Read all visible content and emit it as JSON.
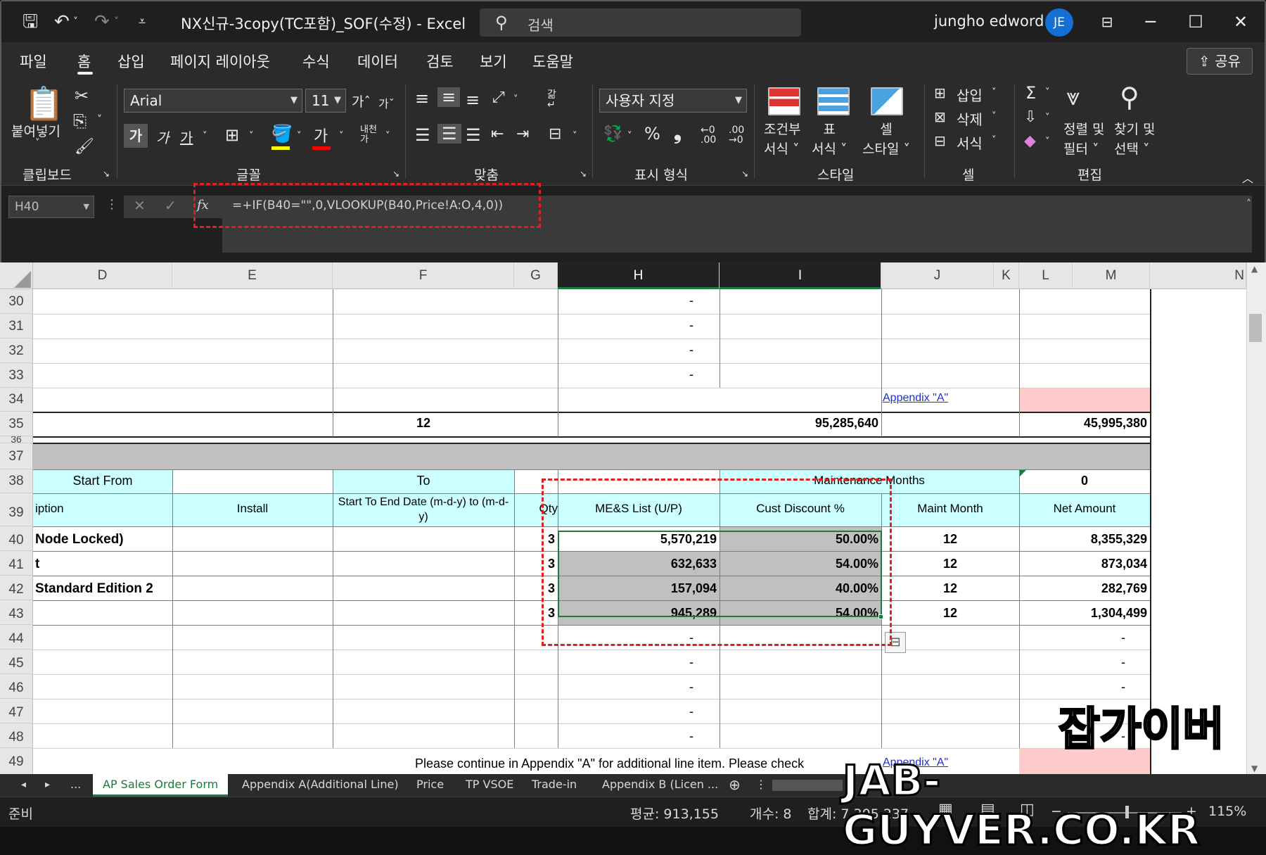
{
  "window": {
    "doc_title": "NX신규-3copy(TC포함)_SOF(수정)  -  Excel",
    "search_placeholder": "검색",
    "user_name": "jungho edword",
    "avatar_initials": "JE",
    "minimize": "─",
    "maximize": "☐",
    "close": "✕"
  },
  "menu": {
    "items": [
      "파일",
      "홈",
      "삽입",
      "페이지 레이아웃",
      "수식",
      "데이터",
      "검토",
      "보기",
      "도움말"
    ],
    "share": "공유"
  },
  "ribbon": {
    "clipboard": {
      "paste": "붙여넣기",
      "label": "클립보드"
    },
    "font": {
      "name": "Arial",
      "size": "11",
      "bold": "가",
      "italic": "가",
      "underline": "가",
      "label": "글꼴"
    },
    "align": {
      "label": "맞춤"
    },
    "number": {
      "format": "사용자 지정",
      "percent": "%",
      "comma": "❟",
      "label": "표시 형식"
    },
    "styles": {
      "cond_format": "조건부\n서식 ˅",
      "table_format": "표\n서식 ˅",
      "cell_style": "셀\n스타일 ˅",
      "label": "스타일"
    },
    "cells": {
      "insert": "삽입",
      "delete": "삭제",
      "format": "서식",
      "label": "셀"
    },
    "edit": {
      "sum": "Σ",
      "sort": "정렬 및\n필터 ˅",
      "find": "찾기 및\n선택 ˅",
      "label": "편집"
    }
  },
  "formula_bar": {
    "name_box": "H40",
    "fx": "fx",
    "formula": "=+IF(B40=\"\",0,VLOOKUP(B40,Price!A:O,4,0))"
  },
  "columns": [
    "D",
    "E",
    "F",
    "G",
    "H",
    "I",
    "J",
    "K",
    "L",
    "M",
    "N"
  ],
  "rows": {
    "r30": {
      "num": "30",
      "h": "-"
    },
    "r31": {
      "num": "31",
      "h": "-"
    },
    "r32": {
      "num": "32",
      "h": "-"
    },
    "r33": {
      "num": "33",
      "h": "-"
    },
    "r34": {
      "num": "34",
      "link": "Appendix \"A\""
    },
    "r35": {
      "num": "35",
      "f": "12",
      "i": "95,285,640",
      "m": "45,995,380"
    },
    "r36": {
      "num": "36"
    },
    "r37": {
      "num": "37"
    },
    "r38": {
      "num": "38",
      "d": "Start From",
      "f": "To",
      "i": "Maintenance Months",
      "m": "0"
    },
    "r39": {
      "num": "39",
      "d": "iption",
      "e": "Install",
      "f": "Start To End Date    (m-d-y) to (m-d-y)",
      "g": "Qty",
      "h": "ME&S List (U/P)",
      "i": "Cust Discount %",
      "j": "Maint Month",
      "m": "Net Amount"
    },
    "r40": {
      "num": "40",
      "d": "Node Locked)",
      "g": "3",
      "h": "5,570,219",
      "i": "50.00%",
      "j": "12",
      "m": "8,355,329"
    },
    "r41": {
      "num": "41",
      "d": "t",
      "g": "3",
      "h": "632,633",
      "i": "54.00%",
      "j": "12",
      "m": "873,034"
    },
    "r42": {
      "num": "42",
      "d": "Standard Edition 2",
      "g": "3",
      "h": "157,094",
      "i": "40.00%",
      "j": "12",
      "m": "282,769"
    },
    "r43": {
      "num": "43",
      "d": "",
      "g": "3",
      "h": "945,289",
      "i": "54.00%",
      "j": "12",
      "m": "1,304,499"
    },
    "r44": {
      "num": "44",
      "h": "-",
      "m": "-"
    },
    "r45": {
      "num": "45",
      "h": "-",
      "m": "-"
    },
    "r46": {
      "num": "46",
      "h": "-",
      "m": "-"
    },
    "r47": {
      "num": "47",
      "h": "-",
      "m": "-"
    },
    "r48": {
      "num": "48",
      "h": "-",
      "m": "-"
    },
    "r49": {
      "num": "49",
      "note": "Please continue in Appendix \"A\" for additional line item. Please check",
      "link": "Appendix \"A\""
    }
  },
  "sheet_tabs": [
    "AP Sales Order Form",
    "Appendix A(Additional Line)",
    "Price",
    "TP VSOE",
    "Trade-in",
    "Appendix B (Licen ..."
  ],
  "status": {
    "ready": "준비",
    "average": "평균: 913,155",
    "count": "개수: 8",
    "sum": "합계: 7,305,237",
    "zoom": "115%"
  },
  "watermark": {
    "korean": "잡가이버",
    "site": "JAB-GUYVER.CO.KR"
  },
  "colors": {
    "accent_green": "#1d7a3e",
    "cyan_header": "#ccffff",
    "highlight_red": "#e02020",
    "pink_cell": "#ffcccc"
  }
}
